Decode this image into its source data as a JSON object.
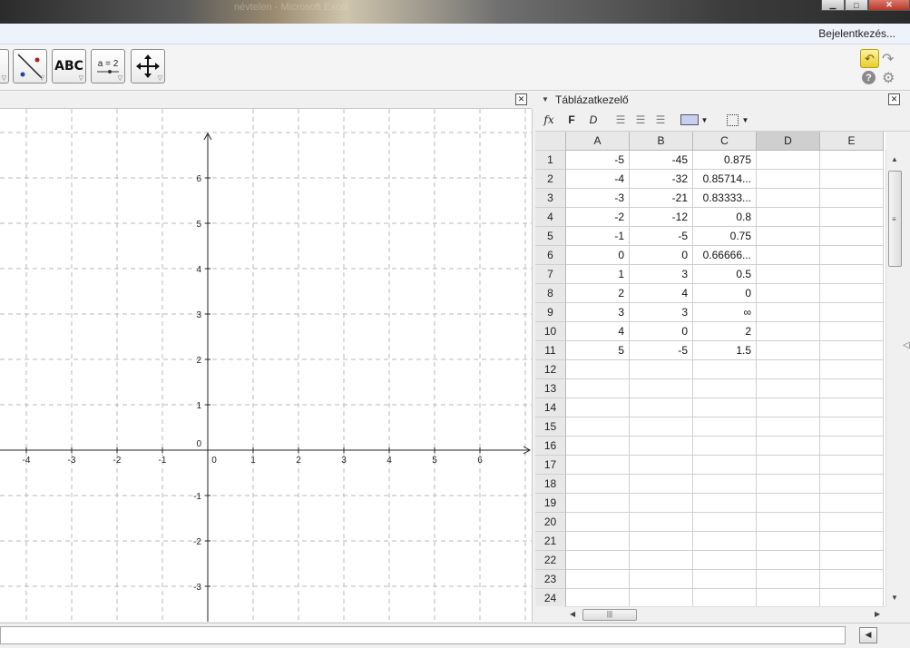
{
  "window": {
    "title": "névtelen - Microsoft Excel"
  },
  "menubar": {
    "login_label": "Bejelentkezés..."
  },
  "toolbar": {
    "text_tool_label": "ABC",
    "slider_tool_label": "a = 2"
  },
  "spreadsheet": {
    "title": "Táblázatkezelő",
    "bold_label": "F",
    "italic_label": "D",
    "fx_label": "fx",
    "columns": [
      "A",
      "B",
      "C",
      "D",
      "E"
    ],
    "selected_column": "D",
    "row_numbers": [
      "1",
      "2",
      "3",
      "4",
      "5",
      "6",
      "7",
      "8",
      "9",
      "10",
      "11",
      "12",
      "13",
      "14",
      "15",
      "16",
      "17",
      "18",
      "19",
      "20",
      "21",
      "22",
      "23",
      "24"
    ],
    "rows": [
      [
        "-5",
        "-45",
        "0.875"
      ],
      [
        "-4",
        "-32",
        "0.85714..."
      ],
      [
        "-3",
        "-21",
        "0.83333..."
      ],
      [
        "-2",
        "-12",
        "0.8"
      ],
      [
        "-1",
        "-5",
        "0.75"
      ],
      [
        "0",
        "0",
        "0.66666..."
      ],
      [
        "1",
        "3",
        "0.5"
      ],
      [
        "2",
        "4",
        "0"
      ],
      [
        "3",
        "3",
        "∞"
      ],
      [
        "4",
        "0",
        "2"
      ],
      [
        "5",
        "-5",
        "1.5"
      ]
    ]
  },
  "graphics": {
    "x_ticks": [
      "-4",
      "-3",
      "-2",
      "-1",
      "0",
      "1",
      "2",
      "3",
      "4",
      "5",
      "6"
    ],
    "y_ticks_pos": [
      "6",
      "5",
      "4",
      "3",
      "2",
      "1",
      "0"
    ],
    "y_ticks_neg": [
      "-1",
      "-2",
      "-3"
    ]
  },
  "colors": {
    "accent": "#e8cc30",
    "grid": "#b8b8b8"
  }
}
